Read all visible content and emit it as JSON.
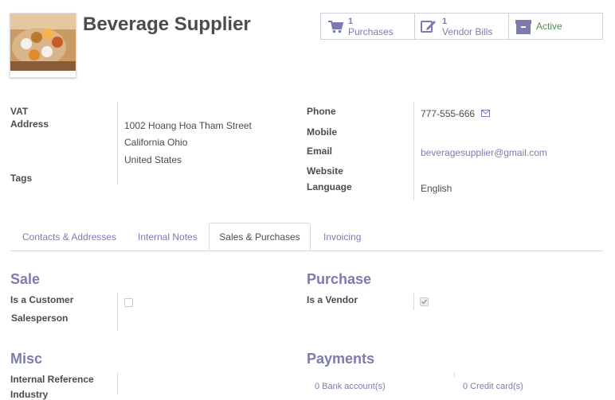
{
  "partner": {
    "name": "Beverage Supplier",
    "image_icon": "beverage-flight-photo"
  },
  "smart_buttons": {
    "purchases": {
      "count": "1",
      "label": "Purchases",
      "icon": "cart-icon"
    },
    "vendor_bills": {
      "count": "1",
      "label": "Vendor Bills",
      "icon": "edit-icon"
    },
    "active": {
      "label": "Active",
      "icon": "archive-icon"
    }
  },
  "left_fields": {
    "vat_label": "VAT",
    "address_label": "Address",
    "address_line1": "1002 Hoang Hoa Tham Street",
    "address_line2": "California Ohio",
    "address_line3": "United States",
    "tags_label": "Tags"
  },
  "right_fields": {
    "phone_label": "Phone",
    "phone_value": "777-555-666",
    "mobile_label": "Mobile",
    "email_label": "Email",
    "email_value": "beveragesupplier@gmail.com",
    "website_label": "Website",
    "language_label": "Language",
    "language_value": "English"
  },
  "tabs": [
    {
      "label": "Contacts & Addresses",
      "active": false
    },
    {
      "label": "Internal Notes",
      "active": false
    },
    {
      "label": "Sales & Purchases",
      "active": true
    },
    {
      "label": "Invoicing",
      "active": false
    }
  ],
  "sale": {
    "title": "Sale",
    "is_customer_label": "Is a Customer",
    "is_customer_checked": false,
    "salesperson_label": "Salesperson"
  },
  "purchase": {
    "title": "Purchase",
    "is_vendor_label": "Is a Vendor",
    "is_vendor_checked": true
  },
  "misc": {
    "title": "Misc",
    "internal_reference_label": "Internal Reference",
    "industry_label": "Industry"
  },
  "payments": {
    "title": "Payments",
    "bank_accounts": "0 Bank account(s)",
    "credit_cards": "0 Credit card(s)"
  },
  "colors": {
    "accent": "#7c7bad",
    "text": "#4c4c4c",
    "border": "#d9d9d9"
  }
}
